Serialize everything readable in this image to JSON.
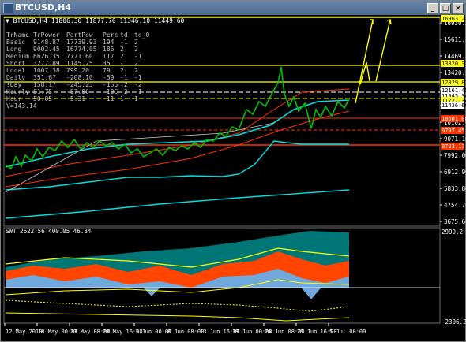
{
  "window": {
    "title": "BTCUSD,H4",
    "buttons": [
      "_",
      "□",
      "×"
    ]
  },
  "main": {
    "header": "▼ BTCUSD,H4  11806.30 11877.70 11346.10 11449.60",
    "price_labels": [
      "16930.20",
      "15611.30",
      "14469.39",
      "13420.20",
      "12362.30",
      "11363.40",
      "10102.90",
      "9071.10",
      "7992.00",
      "6912.90",
      "5833.80",
      "4754.70",
      "3675.60"
    ],
    "markers": [
      {
        "text": "16963.23",
        "color": "#ffff00",
        "fg": "#000000"
      },
      {
        "text": "13820.31",
        "color": "#ffff00",
        "fg": "#000000"
      },
      {
        "text": "12829.87",
        "color": "#ffff00",
        "fg": "#000000"
      },
      {
        "text": "12161.45",
        "color": "#ffffff",
        "fg": "#000000"
      },
      {
        "text": "11945.34",
        "color": "#ffffff",
        "fg": "#000000"
      },
      {
        "text": "11727.34",
        "color": "#ffff00",
        "fg": "#000000"
      },
      {
        "text": "11436.60",
        "color": "#ffffff",
        "fg": "#000000"
      },
      {
        "text": "10601.00",
        "color": "#ff3300",
        "fg": "#ffffff"
      },
      {
        "text": "9797.45",
        "color": "#ff3300",
        "fg": "#ffffff"
      },
      {
        "text": "8723.17",
        "color": "#ff3300",
        "fg": "#ffffff"
      }
    ],
    "trend_table": {
      "headers": [
        "TrName",
        "TrPower",
        "PartPow",
        "Perc",
        "td",
        "td_0"
      ],
      "rows": [
        [
          "Basic",
          "9148.87",
          "17739.93",
          "194",
          "-1",
          "2"
        ],
        [
          "Long",
          "9002.45",
          "16774.05",
          "186",
          "2",
          "2"
        ],
        [
          "Medium",
          "6626.35",
          "7771.60",
          "117",
          "2",
          "-1"
        ],
        [
          "Short",
          "3277.89",
          "1145.25",
          "35",
          "-1",
          "2"
        ],
        [
          "Local",
          "1007.38",
          "799.20",
          "79",
          "2",
          "2"
        ],
        [
          "Daily",
          "351.67",
          "-208.10",
          "-59",
          "-1",
          "-1"
        ],
        [
          "!Day",
          "158.17",
          "-245.23",
          "-155",
          "-2",
          "-2"
        ],
        [
          "Hourly",
          "81.75",
          "-87.06",
          "-106",
          "-2",
          "-1"
        ],
        [
          "Hour",
          "50.05",
          "-5.31",
          "-11",
          "1",
          "1"
        ]
      ],
      "v_label": "V=143.14"
    }
  },
  "indicator": {
    "header": "SWT 2622.56 400.05 46.84",
    "axis_labels": [
      "2999.2",
      "-2306.2"
    ]
  },
  "time_axis": [
    "12 May 2019",
    "18 May 00:00",
    "23 May 08:00",
    "28 May 16:00",
    "3 Jun 00:00",
    "8 Jun 08:00",
    "13 Jun 16:00",
    "19 Jun 00:00",
    "24 Jun 08:00",
    "29 Jun 16:00",
    "5 Jul 00:00"
  ],
  "colors": {
    "bull": "#00c000",
    "panel_bg": "#000000",
    "cyan": "#00e0e0",
    "yellow": "#ffff00",
    "orange": "#ff4500",
    "teal": "#008b8b"
  }
}
